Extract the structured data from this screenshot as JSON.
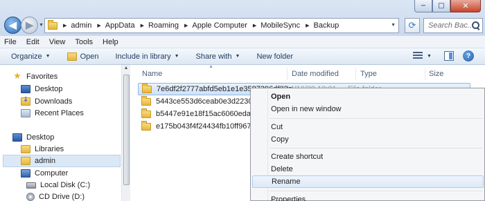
{
  "window": {
    "minimize_glyph": "−",
    "maximize_glyph": "□",
    "close_glyph": "✕"
  },
  "address": {
    "crumbs": [
      "admin",
      "AppData",
      "Roaming",
      "Apple Computer",
      "MobileSync",
      "Backup"
    ]
  },
  "search": {
    "placeholder": "Search Bac..."
  },
  "menubar": {
    "items": [
      "File",
      "Edit",
      "View",
      "Tools",
      "Help"
    ]
  },
  "toolbar": {
    "organize": "Organize",
    "open": "Open",
    "include_in_library": "Include in library",
    "share_with": "Share with",
    "new_folder": "New folder"
  },
  "nav": {
    "favorites": "Favorites",
    "desktop_fav": "Desktop",
    "downloads": "Downloads",
    "recent_places": "Recent Places",
    "desktop": "Desktop",
    "libraries": "Libraries",
    "admin": "admin",
    "computer": "Computer",
    "local_disk": "Local Disk (C:)",
    "cd_drive": "CD Drive (D:)"
  },
  "columns": {
    "name": "Name",
    "date_modified": "Date modified",
    "type": "Type",
    "size": "Size"
  },
  "files": [
    {
      "name": "7e6df2f2777abfd5eb1e1e3587396df02a",
      "date": "2014/10/29 10:01",
      "type": "File folder"
    },
    {
      "name": "5443ce553d6ceab0e3d22302498718",
      "date": "",
      "type": ""
    },
    {
      "name": "b5447e91e18f15ac6060edae5a28",
      "date": "",
      "type": ""
    },
    {
      "name": "e175b043f4f24434fb10ff967e8000",
      "date": "",
      "type": ""
    }
  ],
  "context_menu": {
    "open": "Open",
    "open_new_window": "Open in new window",
    "cut": "Cut",
    "copy": "Copy",
    "create_shortcut": "Create shortcut",
    "delete": "Delete",
    "rename": "Rename",
    "properties": "Properties"
  }
}
